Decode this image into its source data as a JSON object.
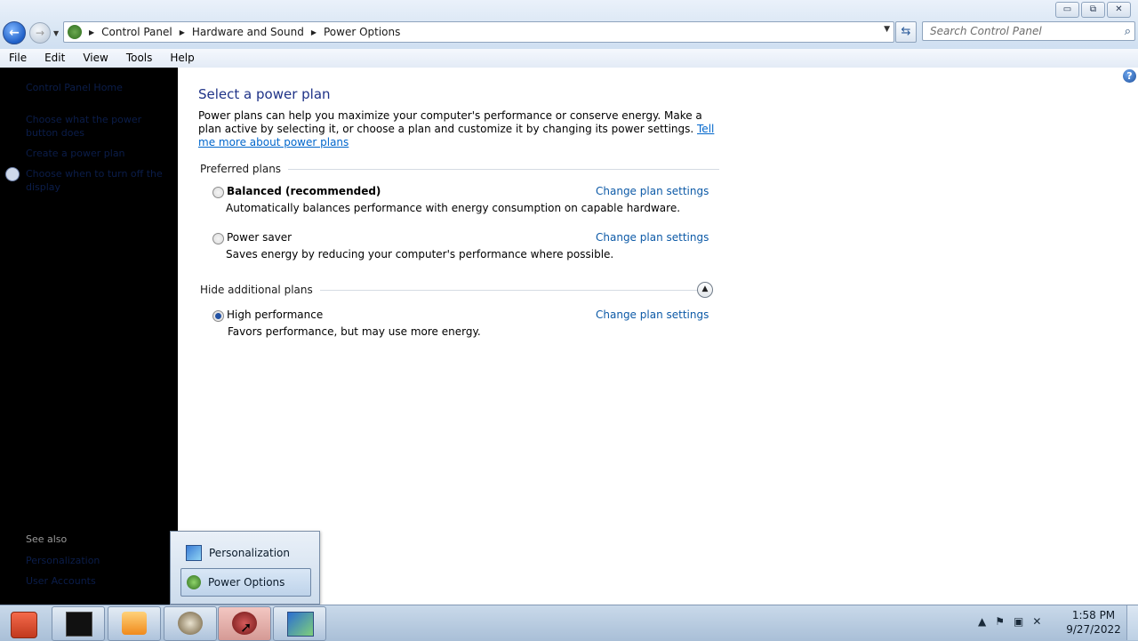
{
  "window": {
    "buttons": {
      "minimize": "▭",
      "maximize": "⧉",
      "close": "✕"
    }
  },
  "address": {
    "breadcrumbs": [
      "Control Panel",
      "Hardware and Sound",
      "Power Options"
    ],
    "search_placeholder": "Search Control Panel"
  },
  "menubar": [
    "File",
    "Edit",
    "View",
    "Tools",
    "Help"
  ],
  "sidebar": {
    "links": [
      "Control Panel Home",
      "Choose what the power button does",
      "Create a power plan",
      "Choose when to turn off the display"
    ],
    "see_also_title": "See also",
    "see_also_links": [
      "Personalization",
      "User Accounts"
    ]
  },
  "main": {
    "title": "Select a power plan",
    "intro_text": "Power plans can help you maximize your computer's performance or conserve energy. Make a plan active by selecting it, or choose a plan and customize it by changing its power settings.",
    "intro_link": "Tell me more about power plans",
    "preferred_label": "Preferred plans",
    "additional_label": "Hide additional plans",
    "plans": [
      {
        "name": "Balanced (recommended)",
        "desc": "Automatically balances performance with energy consumption on capable hardware.",
        "link": "Change plan settings",
        "selected": false
      },
      {
        "name": "Power saver",
        "desc": "Saves energy by reducing your computer's performance where possible.",
        "link": "Change plan settings",
        "selected": false
      },
      {
        "name": "High performance",
        "desc": "Favors performance, but may use more energy.",
        "link": "Change plan settings",
        "selected": true
      }
    ]
  },
  "popup": {
    "items": [
      "Personalization",
      "Power Options"
    ],
    "selected": "Power Options"
  },
  "taskbar": {
    "time": "1:58 PM",
    "date": "9/27/2022"
  },
  "colors": {
    "link": "#0d5aa7",
    "title": "#1e3287",
    "sidebar_bg": "#000000"
  }
}
